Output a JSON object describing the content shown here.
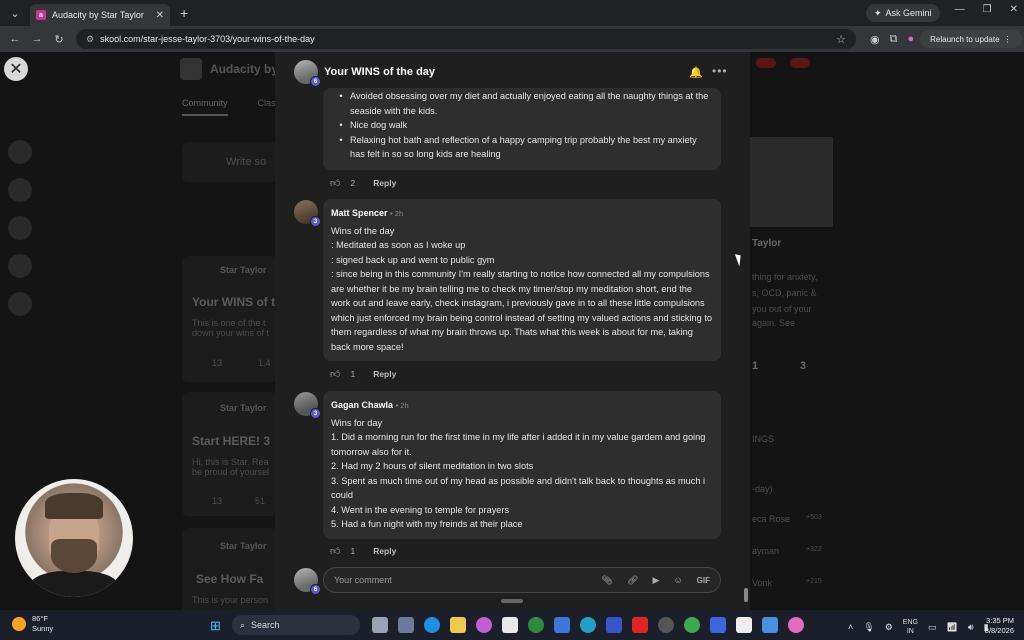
{
  "browser": {
    "tab_title": "Audacity by Star Taylor",
    "tab_favicon_letter": "a",
    "url": "skool.com/star-jesse-taylor-3703/your-wins-of-the-day",
    "ask_gemini": "Ask Gemini",
    "relaunch": "Relaunch to update"
  },
  "background": {
    "group_name": "Audacity by S",
    "nav": [
      "Community",
      "Clas"
    ],
    "compose_placeholder": "Write so",
    "posts": [
      {
        "author": "Star Taylor",
        "title": "Your WINS of t",
        "body": "This is one of the t\ndown your wins of t",
        "likes": "13",
        "comments": "1.4"
      },
      {
        "author": "Star Taylor",
        "title": "Start HERE! 3",
        "body": "Hi, this is Star. Rea\nbe proud of yoursel",
        "likes": "13",
        "comments": "51"
      },
      {
        "author": "Star Taylor",
        "title": "See How Fa",
        "body": "This is your person"
      }
    ],
    "right_name": "Taylor",
    "right_text": [
      "thing for anxiety,",
      "s, OCD, panic &",
      "you out of your",
      "again. See"
    ],
    "right_stats": [
      "1",
      "3"
    ],
    "leaderboard": [
      "-day)",
      "eca Rose",
      "+503",
      "ayman",
      "+322",
      "Vonk",
      "+215"
    ],
    "right_heading": "INGS"
  },
  "modal": {
    "title": "Your WINS of the day",
    "author_level": "6",
    "first_comment": {
      "bullets": [
        "Avoided obsessing over my diet and actually enjoyed eating all the naughty things at the seaside with the kids.",
        "Nice dog walk",
        "Relaxing hot bath and reflection of a happy camping trip probably the best my anxiety has felt in so so long kids are healing"
      ],
      "likes": "2",
      "reply": "Reply"
    },
    "comments": [
      {
        "author": "Matt Spencer",
        "time": "• 2h",
        "level": "3",
        "lines": [
          "Wins of the day",
          ": Meditated as soon as I woke up",
          ": signed back up and went to public gym",
          ": since being in this community I'm really starting to notice how connected all my compulsions are whether it be my brain telling me to check my timer/stop my meditation short, end the work out and leave early, check instagram, i previously gave in to all these little compulsions which just enforced my brain being control instead of setting my valued actions and sticking to them regardless of what my brain throws up. Thats what this week is about for me, taking back more space!"
        ],
        "likes": "1",
        "reply": "Reply"
      },
      {
        "author": "Gagan Chawla",
        "time": "• 2h",
        "level": "3",
        "lines": [
          "Wins for day",
          "1. Did a morning run for the first time in my life after i added it in my value gardem and going tomorrow also for it.",
          "2. Had my 2 hours of silent meditation in two slots",
          "3. Spent as much time out of my head as possible and didn't talk back to thoughts as much i could",
          "4. Went in the evening to temple for prayers",
          "5. Had a fun night with my freinds at their place"
        ],
        "likes": "1",
        "reply": "Reply"
      }
    ],
    "comment_input": {
      "placeholder": "Your comment",
      "level": "6",
      "gif": "GIF"
    }
  },
  "taskbar": {
    "weather_temp": "86°F",
    "weather_desc": "Sunny",
    "search": "Search",
    "lang_top": "ENG",
    "lang_bottom": "IN",
    "time": "3:35 PM",
    "date": "8/8/2026"
  },
  "colors": {
    "modal_bg": "#1f1f1f",
    "bubble_bg": "#2e2e2e",
    "level_badge": "#5b5bd6",
    "bell": "#f2c94c"
  }
}
